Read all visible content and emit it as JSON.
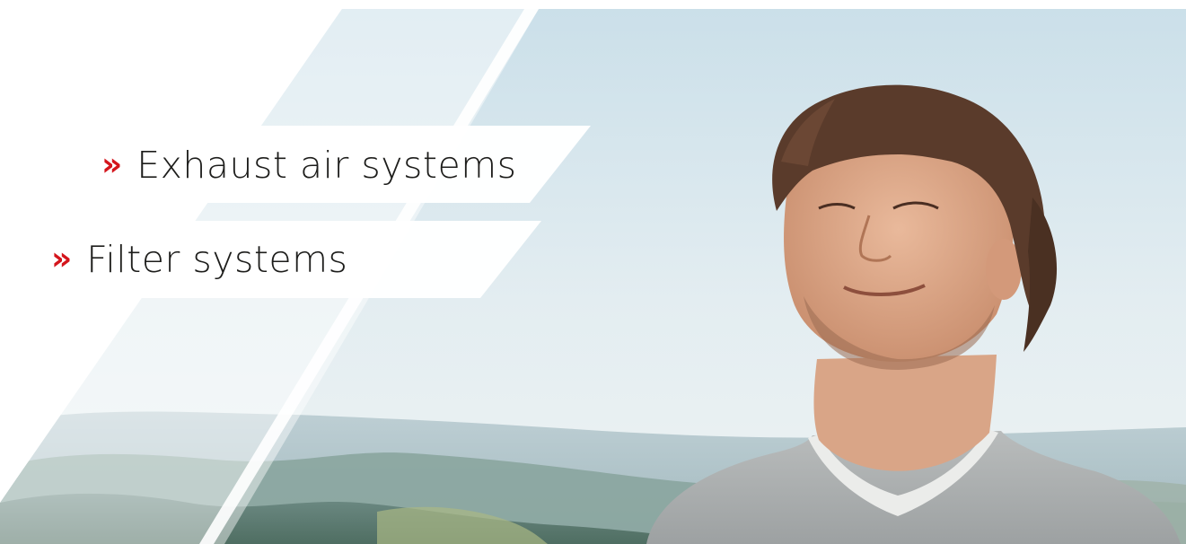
{
  "menu": {
    "items": [
      {
        "label": "Exhaust air systems",
        "icon": "double-chevron-right-icon",
        "marker": "»"
      },
      {
        "label": "Filter systems",
        "icon": "double-chevron-right-icon",
        "marker": "»"
      }
    ]
  },
  "colors": {
    "accent": "#d4151c",
    "text": "#1d1d1b",
    "sky_top": "#cfe0ea",
    "sky_bottom": "#eef4f6",
    "hills": "#7f9aa1"
  }
}
